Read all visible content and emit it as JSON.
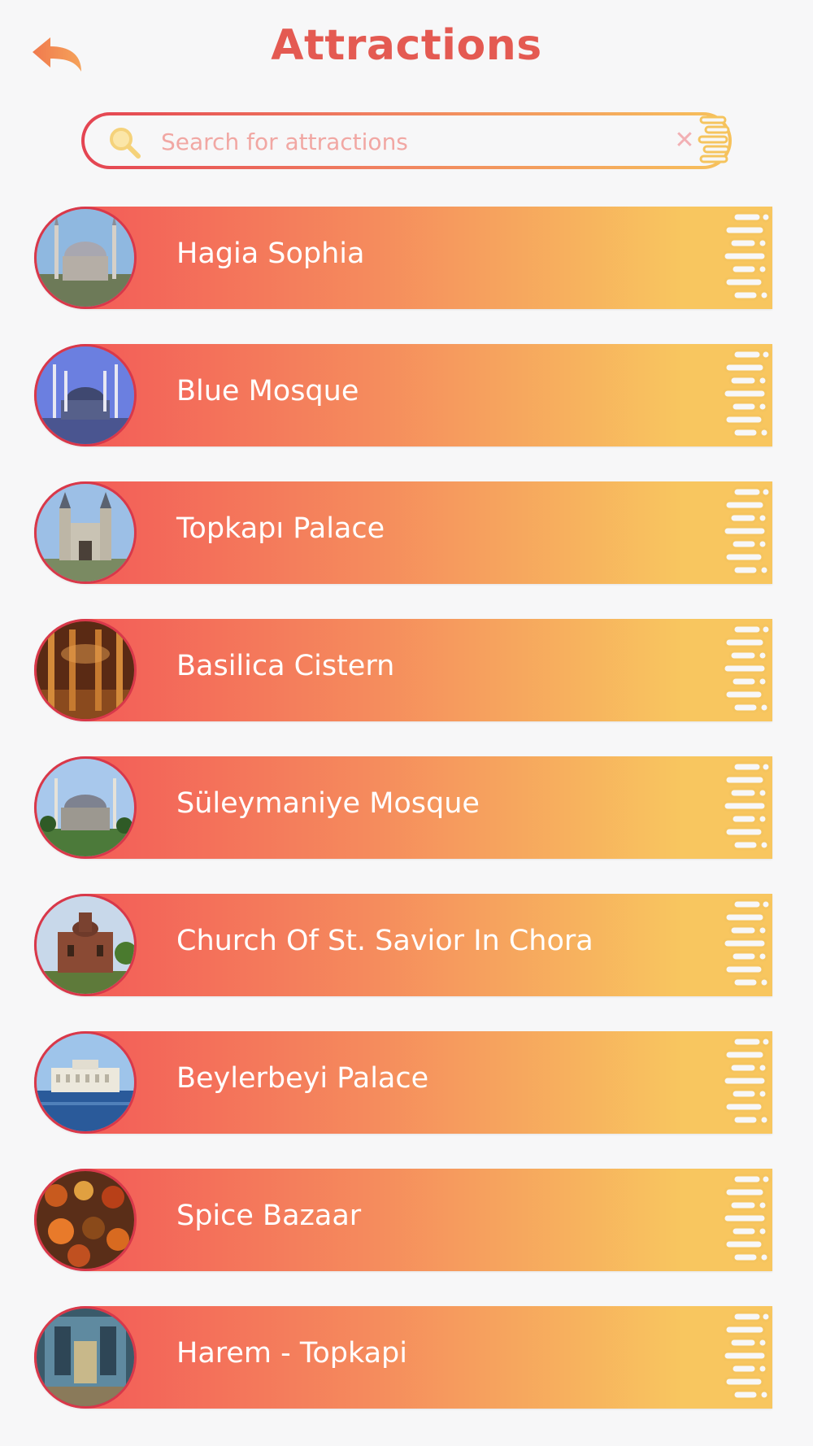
{
  "header": {
    "title": "Attractions"
  },
  "search": {
    "placeholder": "Search for attractions",
    "value": ""
  },
  "colors": {
    "accent": "#e45a52",
    "gradient_start": "#f25457",
    "gradient_end": "#f8c65f",
    "thumb_border": "#d8384a"
  },
  "attractions": [
    {
      "label": "Hagia Sophia"
    },
    {
      "label": "Blue Mosque"
    },
    {
      "label": "Topkapı Palace"
    },
    {
      "label": "Basilica Cistern"
    },
    {
      "label": "Süleymaniye Mosque"
    },
    {
      "label": "Church Of St. Savior In Chora"
    },
    {
      "label": "Beylerbeyi Palace"
    },
    {
      "label": "Spice Bazaar"
    },
    {
      "label": "Harem - Topkapi"
    }
  ],
  "icons": {
    "back": "back-arrow-icon",
    "search": "search-icon",
    "clear": "clear-icon"
  }
}
